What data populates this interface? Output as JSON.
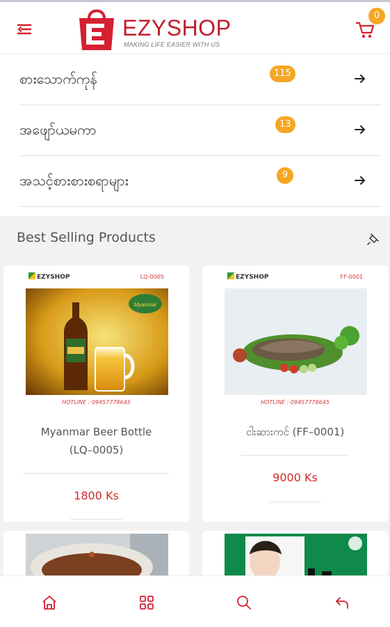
{
  "header": {
    "brand_prefix": "EZY",
    "brand_suffix": "SHOP",
    "tagline": "MAKING LIFE EASIER WITH US",
    "cart_count": "0",
    "icons": {
      "menu": "menu-icon",
      "cart": "cart-icon"
    }
  },
  "categories": [
    {
      "label": "စားသောက်ကုန်",
      "count": "115"
    },
    {
      "label": "အဖျော်ယမကာ",
      "count": "13"
    },
    {
      "label": "အသင့်စားစားစရာများ",
      "count": "9"
    }
  ],
  "section": {
    "title": "Best Selling Products"
  },
  "products": [
    {
      "brand": "EZYSHOP",
      "code": "LQ-0005",
      "hotline": "HOTLINE : 09457778645",
      "name_line1": "Myanmar Beer Bottle",
      "name_line2": "(LQ–0005)",
      "price": "1800 Ks"
    },
    {
      "brand": "EZYSHOP",
      "code": "FF-0001",
      "hotline": "HOTLINE : 09457778645",
      "name_line1": "ငါးဆားကင် (FF–0001)",
      "price": "9000 Ks"
    }
  ],
  "bottom_nav": [
    "home-icon",
    "grid-icon",
    "search-icon",
    "back-icon"
  ],
  "colors": {
    "brand_red": "#c21c2c",
    "badge": "#f5a623",
    "price": "#d62a2a"
  }
}
